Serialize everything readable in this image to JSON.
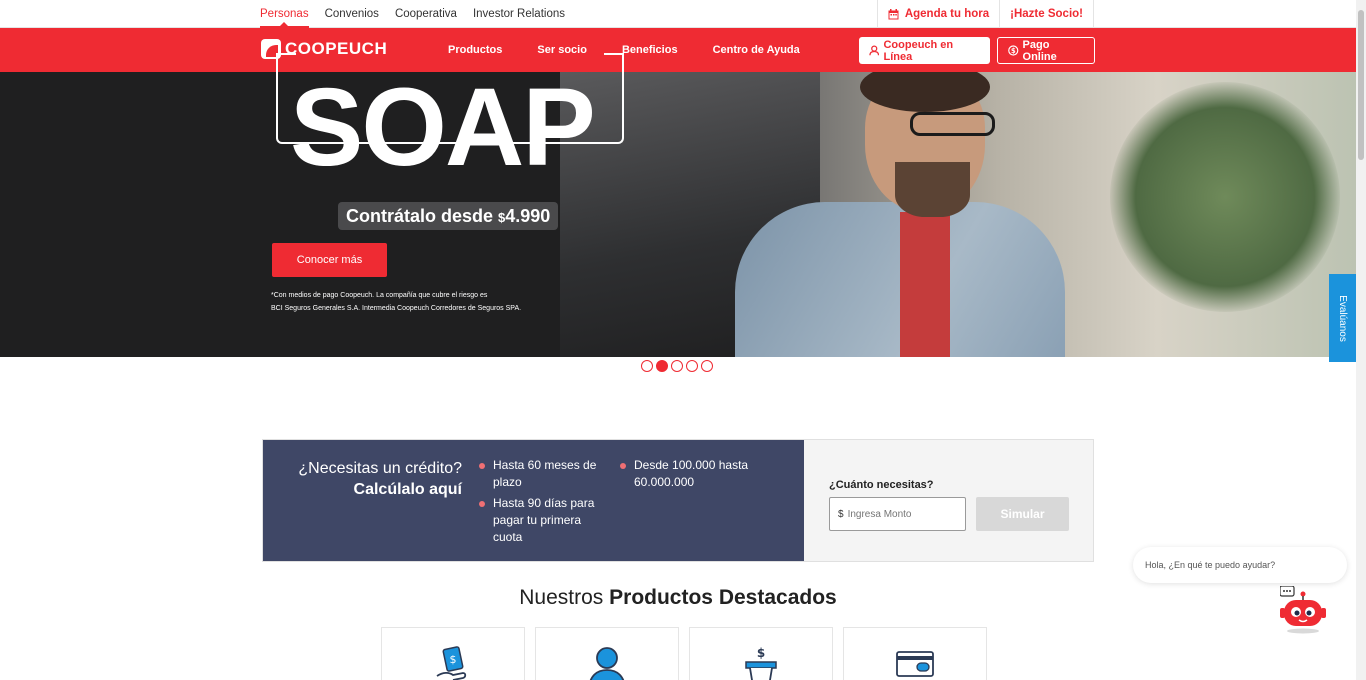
{
  "topbar": {
    "links": [
      "Personas",
      "Convenios",
      "Cooperativa",
      "Investor Relations"
    ],
    "active_index": 0,
    "agenda": "Agenda tu hora",
    "hazte_socio": "¡Hazte Socio!"
  },
  "nav": {
    "logo": "COOPEUCH",
    "items": [
      "Productos",
      "Ser socio",
      "Beneficios",
      "Centro de Ayuda"
    ],
    "online_btn": "Coopeuch en Línea",
    "pago_btn": "Pago Online"
  },
  "hero": {
    "title": "SOAP",
    "price_text": "Contrátalo desde ",
    "price_currency": "$",
    "price_value": "4.990",
    "cta": "Conocer más",
    "disclaimer_line1": "*Con medios de pago Coopeuch. La compañía que cubre el riesgo es",
    "disclaimer_line2": "BCI Seguros Generales S.A. Intermedia Coopeuch Corredores de Seguros SPA.",
    "slides_total": 5,
    "active_slide": 2
  },
  "evaluanos": "Evalúanos",
  "credit": {
    "question": "¿Necesitas un crédito?",
    "cta_text": "Calcúlalo aquí",
    "bullets_left": [
      "Hasta 60 meses de plazo",
      "Hasta 90 días para pagar tu primera cuota"
    ],
    "bullets_right": [
      "Desde 100.000 hasta 60.000.000"
    ],
    "amount_label": "¿Cuánto necesitas?",
    "currency": "$",
    "amount_placeholder": "Ingresa Monto",
    "simulate_btn": "Simular"
  },
  "products": {
    "title_light": "Nuestros ",
    "title_bold": "Productos Destacados",
    "cards": [
      {
        "icon": "money-hand-icon"
      },
      {
        "icon": "user-icon"
      },
      {
        "icon": "piggy-cup-icon"
      },
      {
        "icon": "credit-card-icon"
      }
    ]
  },
  "chat": {
    "greeting": "Hola, ¿En qué te puedo ayudar?"
  },
  "colors": {
    "brand_red": "#ef2b33",
    "credit_navy": "#3f4766",
    "accent_blue": "#1b93dc"
  }
}
